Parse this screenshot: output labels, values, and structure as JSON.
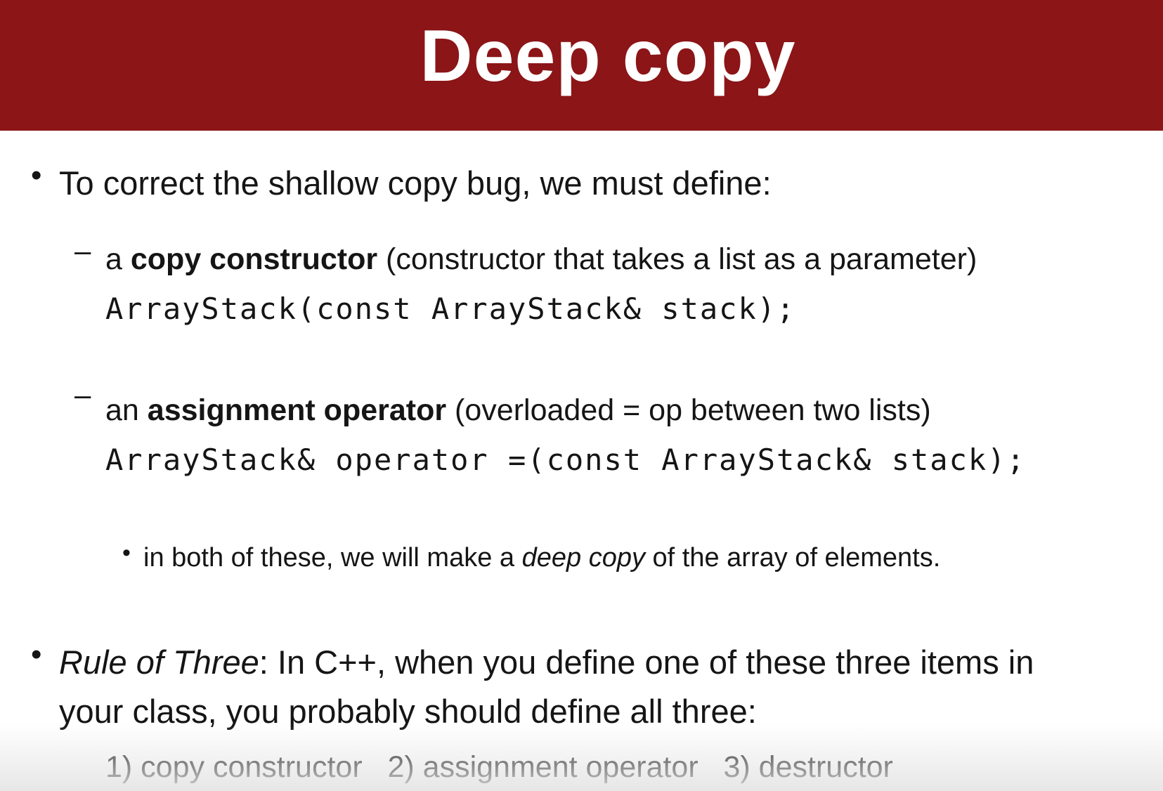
{
  "slide": {
    "title": "Deep copy",
    "bullet1": {
      "text": "To correct the shallow copy bug, we must define:"
    },
    "sub1": {
      "prefix": "a ",
      "bold": "copy constructor",
      "suffix": " (constructor that takes a list as a parameter)",
      "code": "ArrayStack(const ArrayStack& stack);"
    },
    "sub2": {
      "prefix": "an ",
      "bold": "assignment operator",
      "suffix": " (overloaded = op between two lists)",
      "code": "ArrayStack& operator =(const ArrayStack& stack);"
    },
    "note": {
      "prefix": "in both of these, we will make a ",
      "italic": "deep copy",
      "suffix": " of the array of elements."
    },
    "bullet2": {
      "italic": "Rule of Three",
      "line1_rest": ": In C++,  when you define one of these three items in",
      "line2": "your class, you probably should define all three:"
    },
    "items_line": "1) copy constructor   2) assignment operator   3) destructor"
  }
}
